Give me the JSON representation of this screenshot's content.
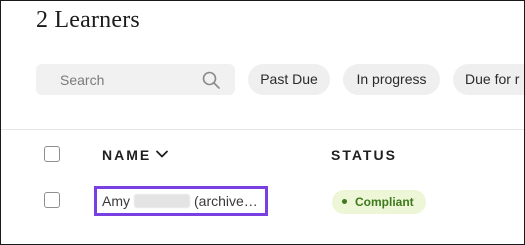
{
  "page": {
    "title": "2 Learners"
  },
  "search": {
    "placeholder": "Search",
    "icon": "search-icon"
  },
  "filters": {
    "chips": [
      {
        "label": "Past Due"
      },
      {
        "label": "In progress"
      },
      {
        "label": "Due for r"
      }
    ]
  },
  "table": {
    "columns": {
      "name": "NAME",
      "status": "STATUS",
      "sort_icon": "chevron-down-icon"
    },
    "rows": [
      {
        "name_first": "Amy",
        "name_suffix": "(archive…",
        "status": "Compliant",
        "status_color": "#3c7a1a",
        "highlight_color": "#7a3fe0"
      }
    ]
  }
}
